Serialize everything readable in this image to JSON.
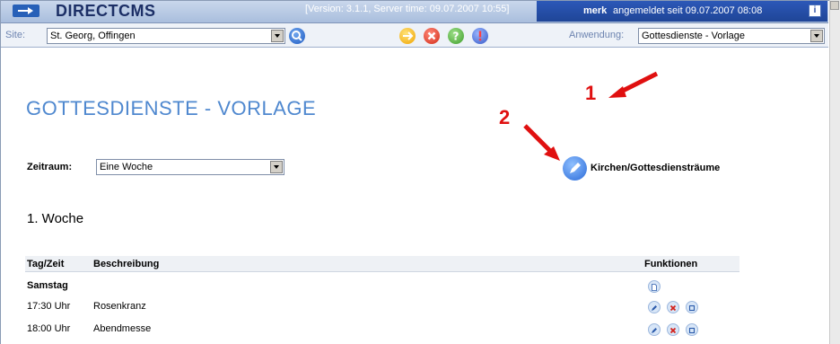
{
  "header": {
    "logo_text": "DIRECTCMS",
    "version_text": "[Version: 3.1.1, Server time: 09.07.2007 10:55]",
    "user": "merk",
    "logged_in_text": "angemeldet seit 09.07.2007 08:08",
    "info_label": "i"
  },
  "toolbar": {
    "site_label": "Site:",
    "site_value": "St. Georg, Offingen",
    "app_label": "Anwendung:",
    "app_value": "Gottesdienste - Vorlage",
    "icons": [
      "search-icon",
      "refresh-icon",
      "cancel-icon",
      "help-icon",
      "alert-icon"
    ]
  },
  "main": {
    "title": "GOTTESDIENSTE - VORLAGE",
    "zeitraum_label": "Zeitraum:",
    "zeitraum_value": "Eine Woche",
    "kirchen_link": "Kirchen/Gottesdiensträume",
    "week_title": "1. Woche",
    "table": {
      "headers": [
        "Tag/Zeit",
        "Beschreibung",
        "Funktionen"
      ],
      "day": "Samstag",
      "rows": [
        {
          "time": "17:30 Uhr",
          "description": "Rosenkranz"
        },
        {
          "time": "18:00 Uhr",
          "description": "Abendmesse"
        }
      ]
    }
  },
  "annotations": [
    {
      "number": "1"
    },
    {
      "number": "2"
    }
  ],
  "colors": {
    "title_blue": "#4f88cf",
    "header_blue": "#1f4597",
    "annotation_red": "#e01010"
  }
}
